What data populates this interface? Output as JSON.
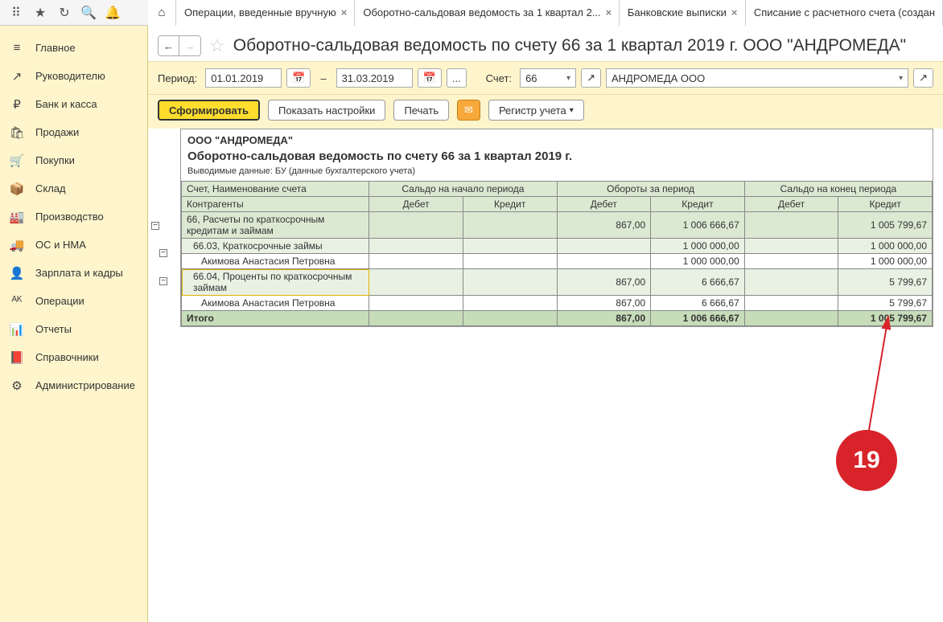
{
  "topIcons": [
    "apps-icon",
    "star-icon",
    "history-icon",
    "search-icon",
    "bell-icon"
  ],
  "tabs": [
    {
      "label": "",
      "home": true
    },
    {
      "label": "Операции, введенные вручную",
      "close": true
    },
    {
      "label": "Оборотно-сальдовая ведомость за 1 квартал 2...",
      "close": true,
      "active": true
    },
    {
      "label": "Банковские выписки",
      "close": true
    },
    {
      "label": "Списание с расчетного счета (создан",
      "close": false
    }
  ],
  "sidebar": [
    {
      "icon": "≡",
      "label": "Главное"
    },
    {
      "icon": "↗",
      "label": "Руководителю"
    },
    {
      "icon": "₽",
      "label": "Банк и касса"
    },
    {
      "icon": "🛍",
      "label": "Продажи"
    },
    {
      "icon": "🛒",
      "label": "Покупки"
    },
    {
      "icon": "📦",
      "label": "Склад"
    },
    {
      "icon": "🏭",
      "label": "Производство"
    },
    {
      "icon": "🚚",
      "label": "ОС и НМА"
    },
    {
      "icon": "👤",
      "label": "Зарплата и кадры"
    },
    {
      "icon": "ᴬᴷ",
      "label": "Операции"
    },
    {
      "icon": "📊",
      "label": "Отчеты"
    },
    {
      "icon": "📕",
      "label": "Справочники"
    },
    {
      "icon": "⚙",
      "label": "Администрирование"
    }
  ],
  "page": {
    "title": "Оборотно-сальдовая ведомость по счету 66 за 1 квартал 2019 г. ООО \"АНДРОМЕДА\"",
    "periodLabel": "Период:",
    "from": "01.01.2019",
    "to": "31.03.2019",
    "dots": "...",
    "accountLabel": "Счет:",
    "account": "66",
    "org": "АНДРОМЕДА ООО"
  },
  "actions": {
    "generate": "Сформировать",
    "settings": "Показать настройки",
    "print": "Печать",
    "register": "Регистр учета"
  },
  "report": {
    "org": "ООО \"АНДРОМЕДА\"",
    "title": "Оборотно-сальдовая ведомость по счету 66 за 1 квартал 2019 г.",
    "sub": "Выводимые данные:  БУ (данные бухгалтерского учета)",
    "head": {
      "c1": "Счет, Наименование счета",
      "c1b": "Контрагенты",
      "g1": "Сальдо на начало периода",
      "g2": "Обороты за период",
      "g3": "Сальдо на конец периода",
      "d": "Дебет",
      "k": "Кредит"
    },
    "rows": [
      {
        "lvl": 0,
        "name": "66, Расчеты по краткосрочным кредитам и займам",
        "sd": "",
        "sk": "",
        "od": "867,00",
        "ok": "1 006 666,67",
        "ed": "",
        "ek": "1 005 799,67"
      },
      {
        "lvl": 1,
        "name": "66.03, Краткосрочные займы",
        "sd": "",
        "sk": "",
        "od": "",
        "ok": "1 000 000,00",
        "ed": "",
        "ek": "1 000 000,00"
      },
      {
        "lvl": 2,
        "name": "Акимова Анастасия Петровна",
        "sd": "",
        "sk": "",
        "od": "",
        "ok": "1 000 000,00",
        "ed": "",
        "ek": "1 000 000,00"
      },
      {
        "lvl": 1,
        "hl": true,
        "name": "66.04, Проценты по краткосрочным займам",
        "sd": "",
        "sk": "",
        "od": "867,00",
        "ok": "6 666,67",
        "ed": "",
        "ek": "5 799,67"
      },
      {
        "lvl": 2,
        "name": "Акимова Анастасия Петровна",
        "sd": "",
        "sk": "",
        "od": "867,00",
        "ok": "6 666,67",
        "ed": "",
        "ek": "5 799,67"
      }
    ],
    "total": {
      "name": "Итого",
      "sd": "",
      "sk": "",
      "od": "867,00",
      "ok": "1 006 666,67",
      "ed": "",
      "ek": "1 005 799,67"
    }
  },
  "annotation": {
    "number": "19"
  }
}
